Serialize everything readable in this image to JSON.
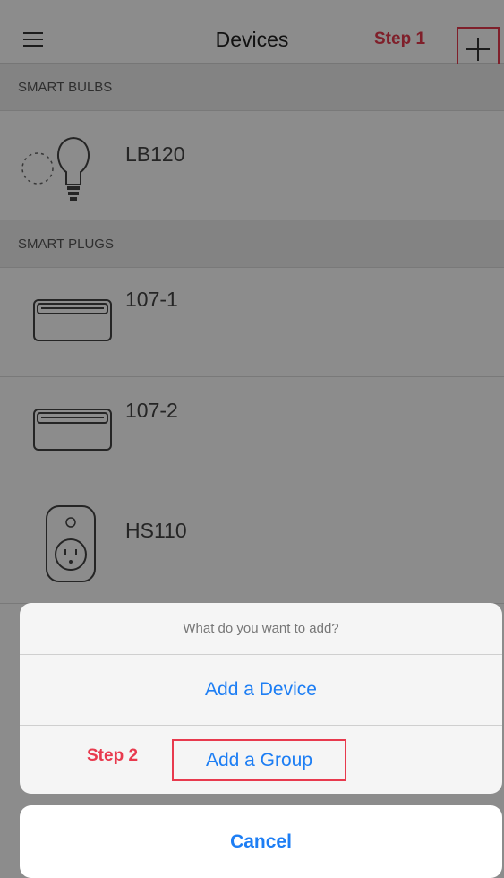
{
  "navbar": {
    "title": "Devices",
    "step1_label": "Step 1"
  },
  "sections": {
    "bulbs_header": "SMART BULBS",
    "plugs_header": "SMART PLUGS"
  },
  "devices": {
    "bulb": "LB120",
    "plug1": "107-1",
    "plug2": "107-2",
    "plug3": "HS110"
  },
  "sheet": {
    "title": "What do you want to add?",
    "add_device": "Add a Device",
    "add_group": "Add a Group",
    "step2_label": "Step 2",
    "cancel": "Cancel"
  },
  "colors": {
    "accent": "#1d7ef4",
    "highlight": "#e83a4e"
  }
}
